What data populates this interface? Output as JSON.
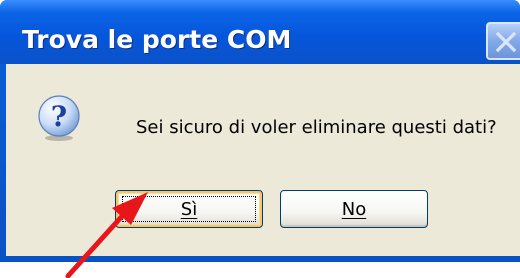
{
  "dialog": {
    "title": "Trova le porte COM",
    "message": "Sei sicuro di voler eliminare questi dati?",
    "icon": "question-icon",
    "buttons": {
      "yes_label": "Sì",
      "no_label": "No"
    }
  },
  "colors": {
    "titlebar": "#0656db",
    "client_bg": "#ece9d8",
    "annotation_arrow": "#e8151b"
  }
}
